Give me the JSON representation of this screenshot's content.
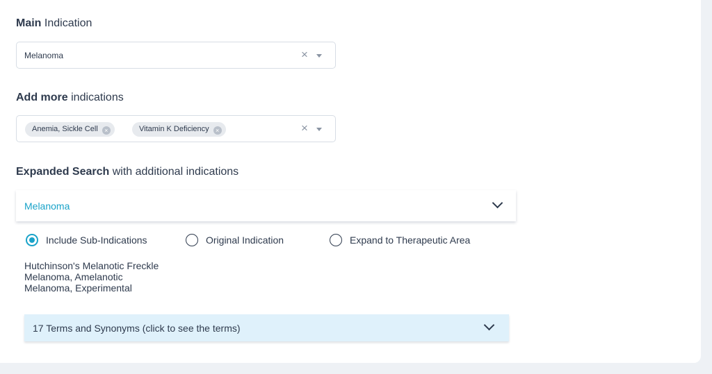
{
  "main_indication": {
    "label_bold": "Main",
    "label_rest": " Indication",
    "value": "Melanoma",
    "clear_icon": "×"
  },
  "more_indications": {
    "label_bold": "Add more",
    "label_rest": " indications",
    "chips": [
      "Anemia, Sickle Cell",
      "Vitamin K Deficiency"
    ],
    "chip_remove_icon": "×",
    "clear_icon": "×"
  },
  "expanded_search": {
    "label_bold": "Expanded Search",
    "label_rest": " with additional indications",
    "accordion_title": "Melanoma",
    "options": [
      {
        "label": "Include Sub-Indications",
        "selected": true
      },
      {
        "label": "Original Indication",
        "selected": false
      },
      {
        "label": "Expand to Therapeutic Area",
        "selected": false
      }
    ],
    "sub_indications": [
      "Hutchinson's Melanotic Freckle",
      "Melanoma, Amelanotic",
      "Melanoma, Experimental"
    ],
    "terms_label": "17 Terms and Synonyms (click to see the terms)"
  },
  "colors": {
    "accent": "#1aa3c9",
    "text": "#2e3a4d",
    "terms_bg": "#dff1fb",
    "page_bg": "#eef1f5"
  }
}
